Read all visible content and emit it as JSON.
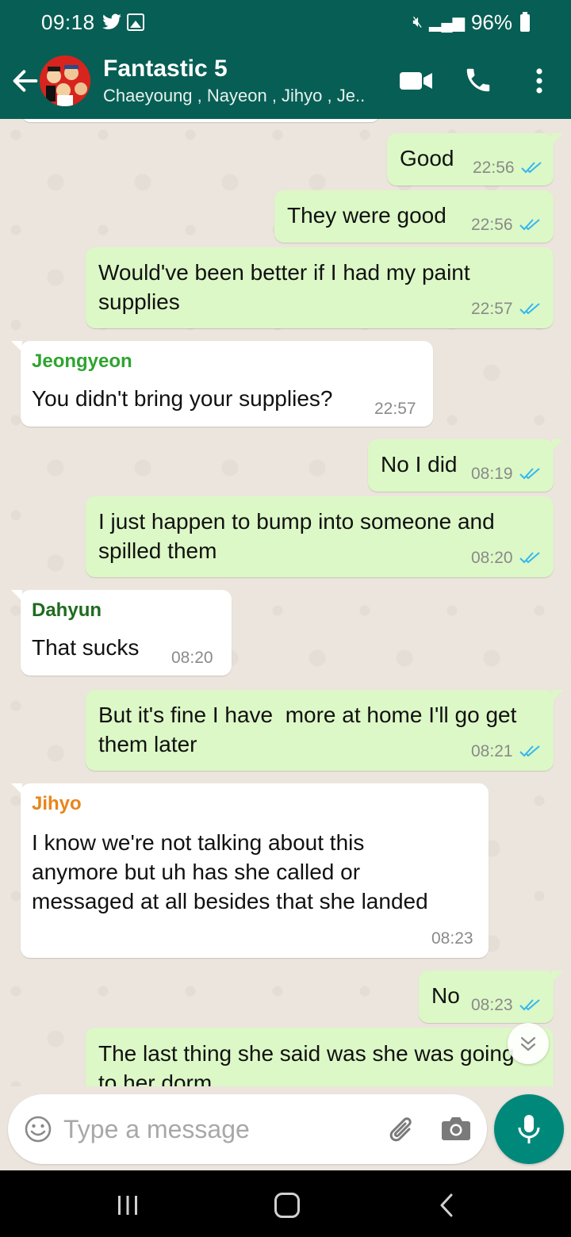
{
  "status_bar": {
    "time": "09:18",
    "battery": "96%"
  },
  "header": {
    "title": "Fantastic 5",
    "subtitle": "Chaeyoung , Nayeon , Jihyo , Je.."
  },
  "colors": {
    "header_bg": "#075e54",
    "outgoing_bubble": "#dcf8c6",
    "incoming_bubble": "#ffffff",
    "read_ticks": "#34b7f1",
    "mic_button": "#00897b"
  },
  "messages": [
    {
      "dir": "out",
      "text": "Good",
      "time": "22:56"
    },
    {
      "dir": "out",
      "text": "They were good",
      "time": "22:56"
    },
    {
      "dir": "out",
      "lines": [
        "Would've been better if I had my paint",
        "supplies"
      ],
      "time": "22:57"
    },
    {
      "dir": "in",
      "sender": "Jeongyeon",
      "sender_color": "#2fa42f",
      "text": "You didn't bring your supplies?",
      "time": "22:57"
    },
    {
      "dir": "out",
      "text": "No I did",
      "time": "08:19"
    },
    {
      "dir": "out",
      "lines": [
        "I just happen to bump into someone and",
        "spilled them"
      ],
      "time": "08:20"
    },
    {
      "dir": "in",
      "sender": "Dahyun",
      "sender_color": "#1e6b1e",
      "text": "That sucks",
      "time": "08:20"
    },
    {
      "dir": "out",
      "lines": [
        "But it's fine I have  more at home I'll go get",
        "them later"
      ],
      "time": "08:21"
    },
    {
      "dir": "in",
      "sender": "Jihyo",
      "sender_color": "#e8851b",
      "lines": [
        "I know we're not talking about this",
        "anymore but uh has she called or",
        "messaged at all besides that she landed"
      ],
      "time": "08:23"
    },
    {
      "dir": "out",
      "text": "No",
      "time": "08:23"
    },
    {
      "dir": "out",
      "lines": [
        "The last thing she said was she was going",
        "to her dorm"
      ],
      "time": ""
    }
  ],
  "input": {
    "placeholder": "Type a message"
  },
  "icons": [
    "back-arrow-icon",
    "group-avatar",
    "video-call-icon",
    "phone-icon",
    "more-vert-icon",
    "emoji-icon",
    "attach-icon",
    "camera-icon",
    "mic-icon",
    "double-tick-icon",
    "scroll-down-icon"
  ]
}
